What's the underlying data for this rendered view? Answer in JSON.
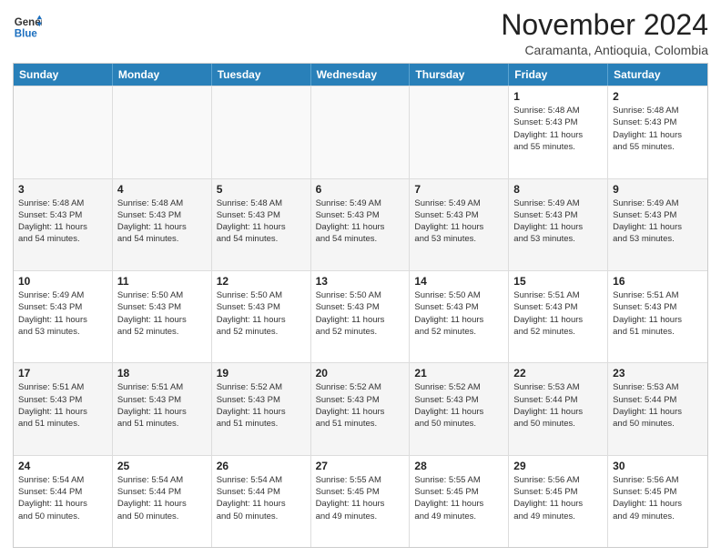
{
  "header": {
    "logo_line1": "General",
    "logo_line2": "Blue",
    "month": "November 2024",
    "location": "Caramanta, Antioquia, Colombia"
  },
  "weekdays": [
    "Sunday",
    "Monday",
    "Tuesday",
    "Wednesday",
    "Thursday",
    "Friday",
    "Saturday"
  ],
  "rows": [
    [
      {
        "day": "",
        "info": ""
      },
      {
        "day": "",
        "info": ""
      },
      {
        "day": "",
        "info": ""
      },
      {
        "day": "",
        "info": ""
      },
      {
        "day": "",
        "info": ""
      },
      {
        "day": "1",
        "info": "Sunrise: 5:48 AM\nSunset: 5:43 PM\nDaylight: 11 hours\nand 55 minutes."
      },
      {
        "day": "2",
        "info": "Sunrise: 5:48 AM\nSunset: 5:43 PM\nDaylight: 11 hours\nand 55 minutes."
      }
    ],
    [
      {
        "day": "3",
        "info": "Sunrise: 5:48 AM\nSunset: 5:43 PM\nDaylight: 11 hours\nand 54 minutes."
      },
      {
        "day": "4",
        "info": "Sunrise: 5:48 AM\nSunset: 5:43 PM\nDaylight: 11 hours\nand 54 minutes."
      },
      {
        "day": "5",
        "info": "Sunrise: 5:48 AM\nSunset: 5:43 PM\nDaylight: 11 hours\nand 54 minutes."
      },
      {
        "day": "6",
        "info": "Sunrise: 5:49 AM\nSunset: 5:43 PM\nDaylight: 11 hours\nand 54 minutes."
      },
      {
        "day": "7",
        "info": "Sunrise: 5:49 AM\nSunset: 5:43 PM\nDaylight: 11 hours\nand 53 minutes."
      },
      {
        "day": "8",
        "info": "Sunrise: 5:49 AM\nSunset: 5:43 PM\nDaylight: 11 hours\nand 53 minutes."
      },
      {
        "day": "9",
        "info": "Sunrise: 5:49 AM\nSunset: 5:43 PM\nDaylight: 11 hours\nand 53 minutes."
      }
    ],
    [
      {
        "day": "10",
        "info": "Sunrise: 5:49 AM\nSunset: 5:43 PM\nDaylight: 11 hours\nand 53 minutes."
      },
      {
        "day": "11",
        "info": "Sunrise: 5:50 AM\nSunset: 5:43 PM\nDaylight: 11 hours\nand 52 minutes."
      },
      {
        "day": "12",
        "info": "Sunrise: 5:50 AM\nSunset: 5:43 PM\nDaylight: 11 hours\nand 52 minutes."
      },
      {
        "day": "13",
        "info": "Sunrise: 5:50 AM\nSunset: 5:43 PM\nDaylight: 11 hours\nand 52 minutes."
      },
      {
        "day": "14",
        "info": "Sunrise: 5:50 AM\nSunset: 5:43 PM\nDaylight: 11 hours\nand 52 minutes."
      },
      {
        "day": "15",
        "info": "Sunrise: 5:51 AM\nSunset: 5:43 PM\nDaylight: 11 hours\nand 52 minutes."
      },
      {
        "day": "16",
        "info": "Sunrise: 5:51 AM\nSunset: 5:43 PM\nDaylight: 11 hours\nand 51 minutes."
      }
    ],
    [
      {
        "day": "17",
        "info": "Sunrise: 5:51 AM\nSunset: 5:43 PM\nDaylight: 11 hours\nand 51 minutes."
      },
      {
        "day": "18",
        "info": "Sunrise: 5:51 AM\nSunset: 5:43 PM\nDaylight: 11 hours\nand 51 minutes."
      },
      {
        "day": "19",
        "info": "Sunrise: 5:52 AM\nSunset: 5:43 PM\nDaylight: 11 hours\nand 51 minutes."
      },
      {
        "day": "20",
        "info": "Sunrise: 5:52 AM\nSunset: 5:43 PM\nDaylight: 11 hours\nand 51 minutes."
      },
      {
        "day": "21",
        "info": "Sunrise: 5:52 AM\nSunset: 5:43 PM\nDaylight: 11 hours\nand 50 minutes."
      },
      {
        "day": "22",
        "info": "Sunrise: 5:53 AM\nSunset: 5:44 PM\nDaylight: 11 hours\nand 50 minutes."
      },
      {
        "day": "23",
        "info": "Sunrise: 5:53 AM\nSunset: 5:44 PM\nDaylight: 11 hours\nand 50 minutes."
      }
    ],
    [
      {
        "day": "24",
        "info": "Sunrise: 5:54 AM\nSunset: 5:44 PM\nDaylight: 11 hours\nand 50 minutes."
      },
      {
        "day": "25",
        "info": "Sunrise: 5:54 AM\nSunset: 5:44 PM\nDaylight: 11 hours\nand 50 minutes."
      },
      {
        "day": "26",
        "info": "Sunrise: 5:54 AM\nSunset: 5:44 PM\nDaylight: 11 hours\nand 50 minutes."
      },
      {
        "day": "27",
        "info": "Sunrise: 5:55 AM\nSunset: 5:45 PM\nDaylight: 11 hours\nand 49 minutes."
      },
      {
        "day": "28",
        "info": "Sunrise: 5:55 AM\nSunset: 5:45 PM\nDaylight: 11 hours\nand 49 minutes."
      },
      {
        "day": "29",
        "info": "Sunrise: 5:56 AM\nSunset: 5:45 PM\nDaylight: 11 hours\nand 49 minutes."
      },
      {
        "day": "30",
        "info": "Sunrise: 5:56 AM\nSunset: 5:45 PM\nDaylight: 11 hours\nand 49 minutes."
      }
    ]
  ]
}
